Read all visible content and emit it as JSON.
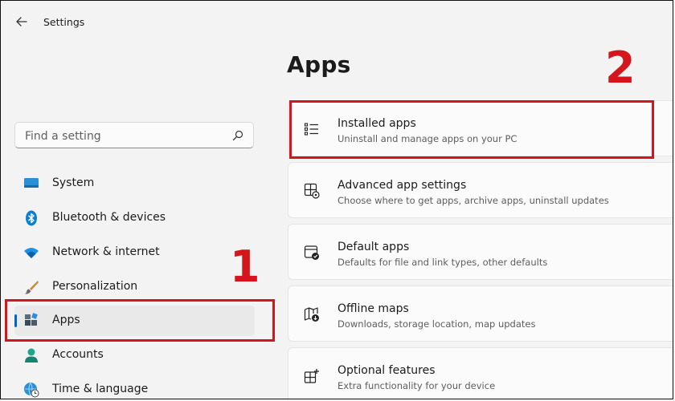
{
  "window": {
    "title": "Settings"
  },
  "search": {
    "placeholder": "Find a setting"
  },
  "sidebar": {
    "items": [
      {
        "label": "System",
        "icon": "system-icon"
      },
      {
        "label": "Bluetooth & devices",
        "icon": "bluetooth-icon"
      },
      {
        "label": "Network & internet",
        "icon": "wifi-icon"
      },
      {
        "label": "Personalization",
        "icon": "brush-icon"
      },
      {
        "label": "Apps",
        "icon": "apps-icon",
        "active": true
      },
      {
        "label": "Accounts",
        "icon": "accounts-icon"
      },
      {
        "label": "Time & language",
        "icon": "globe-clock-icon"
      }
    ]
  },
  "main": {
    "title": "Apps",
    "cards": [
      {
        "title": "Installed apps",
        "desc": "Uninstall and manage apps on your PC",
        "icon": "list-icon"
      },
      {
        "title": "Advanced app settings",
        "desc": "Choose where to get apps, archive apps, uninstall updates",
        "icon": "app-gear-icon"
      },
      {
        "title": "Default apps",
        "desc": "Defaults for file and link types, other defaults",
        "icon": "default-apps-icon"
      },
      {
        "title": "Offline maps",
        "desc": "Downloads, storage location, map updates",
        "icon": "map-icon"
      },
      {
        "title": "Optional features",
        "desc": "Extra functionality for your device",
        "icon": "add-feature-icon"
      }
    ]
  },
  "annotations": {
    "step1": "1",
    "step2": "2",
    "color": "#d4151b"
  },
  "colors": {
    "accent": "#0067c0",
    "background": "#f3f3f3",
    "card": "#fbfbfb"
  }
}
